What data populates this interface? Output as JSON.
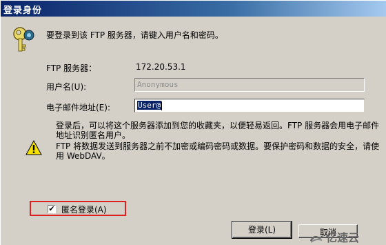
{
  "window": {
    "title": "登录身份"
  },
  "intro_text": "要登录到该 FTP 服务器，请键入用户名和密码。",
  "form": {
    "server_label": "FTP 服务器：",
    "server_value": "172.20.53.1",
    "username_label": "用户名(U):",
    "username_value": "Anonymous",
    "email_label": "电子邮件地址(E):",
    "email_value": "User@"
  },
  "warning": {
    "para1": "登录后，可以将这个服务器添加到您的收藏夹，以便轻易返回。FTP 服务器会用电子邮件地址识别匿名用户。",
    "para2": "FTP 将数据发送到服务器之前不加密或编码密码或数据。要保护密码和数据的安全，请使用 WebDAV。"
  },
  "anonymous": {
    "label": "匿名登录(A)",
    "checked_mark": "✔"
  },
  "buttons": {
    "login": "登录(L)",
    "cancel": "取消"
  },
  "watermark": {
    "text": "亿速云"
  },
  "colors": {
    "title_bar": "#0a246a",
    "dialog_bg": "#d4d0c8",
    "highlight_box": "#e02020"
  },
  "icons": [
    "key-icon",
    "warning-icon",
    "checkbox-check-icon",
    "watermark-logo-icon"
  ]
}
